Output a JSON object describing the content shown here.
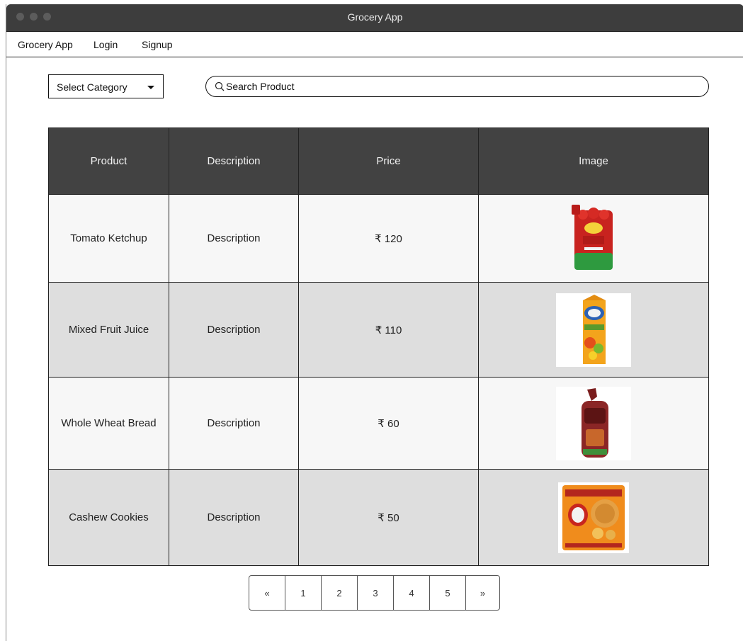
{
  "window": {
    "title": "Grocery App"
  },
  "menu": {
    "items": [
      "Grocery App",
      "Login",
      "Signup"
    ]
  },
  "filters": {
    "category_label": "Select Category",
    "search_placeholder": "Search Product"
  },
  "table": {
    "headers": [
      "Product",
      "Description",
      "Price",
      "Image"
    ],
    "rows": [
      {
        "product": "Tomato Ketchup",
        "description": "Description",
        "price": "₹ 120",
        "image": "ketchup-pouch-image"
      },
      {
        "product": "Mixed Fruit Juice",
        "description": "Description",
        "price": "₹ 110",
        "image": "juice-carton-image"
      },
      {
        "product": "Whole Wheat Bread",
        "description": "Description",
        "price": "₹ 60",
        "image": "bread-loaf-image"
      },
      {
        "product": "Cashew Cookies",
        "description": "Description",
        "price": "₹ 50",
        "image": "cookie-pack-image"
      }
    ]
  },
  "pagination": {
    "prev": "«",
    "pages": [
      "1",
      "2",
      "3",
      "4",
      "5"
    ],
    "next": "»"
  },
  "colors": {
    "titlebar": "#3d3d3d",
    "header_bg": "#424242",
    "row_even": "#dedede",
    "row_odd": "#f7f7f7"
  }
}
